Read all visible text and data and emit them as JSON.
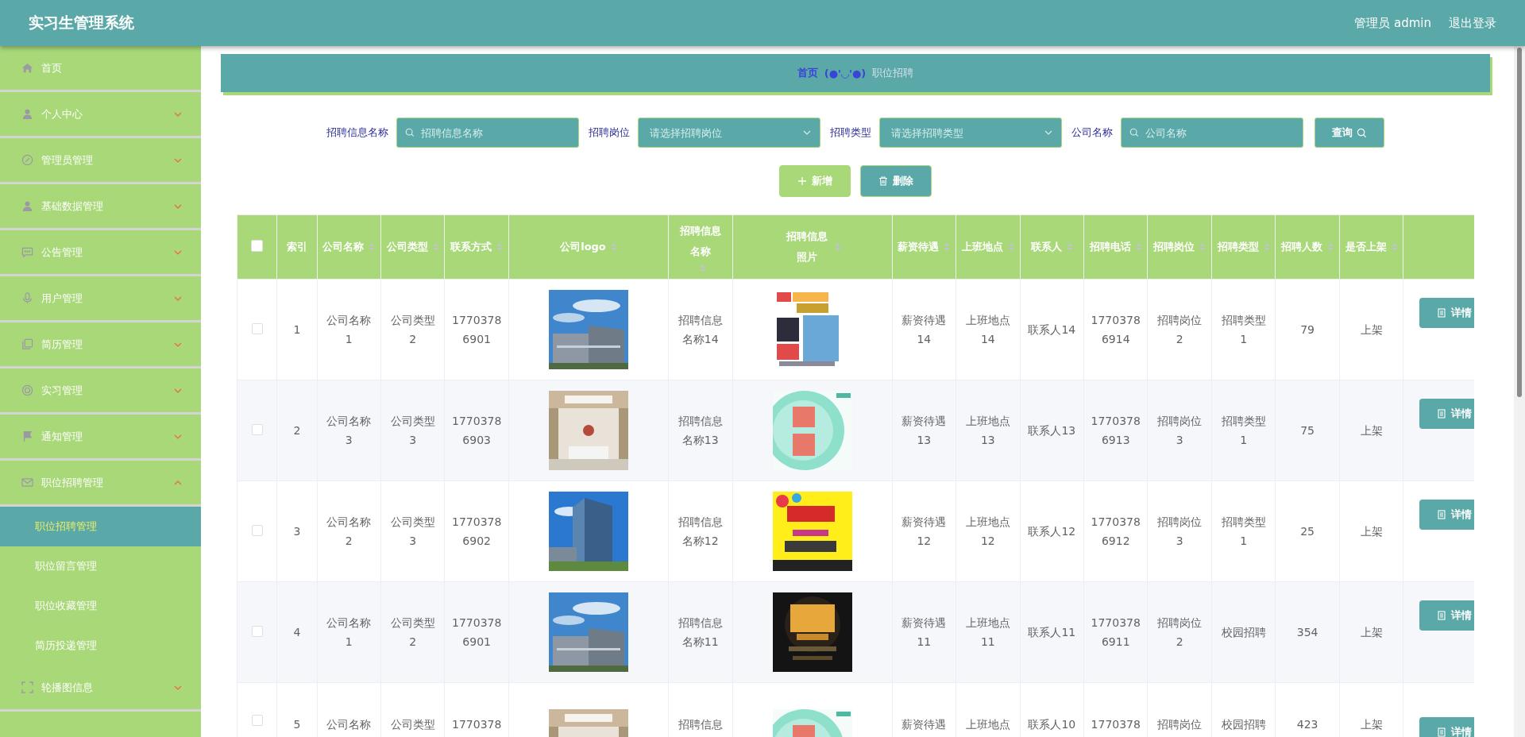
{
  "header": {
    "title": "实习生管理系统",
    "user": "管理员 admin",
    "logout": "退出登录"
  },
  "sidebar": {
    "items": [
      {
        "label": "首页",
        "kind": "link"
      },
      {
        "label": "个人中心",
        "kind": "group",
        "expanded": false
      },
      {
        "label": "管理员管理",
        "kind": "group",
        "expanded": false
      },
      {
        "label": "基础数据管理",
        "kind": "group",
        "expanded": false
      },
      {
        "label": "公告管理",
        "kind": "group",
        "expanded": false
      },
      {
        "label": "用户管理",
        "kind": "group",
        "expanded": false
      },
      {
        "label": "简历管理",
        "kind": "group",
        "expanded": false
      },
      {
        "label": "实习管理",
        "kind": "group",
        "expanded": false
      },
      {
        "label": "通知管理",
        "kind": "group",
        "expanded": false
      },
      {
        "label": "职位招聘管理",
        "kind": "group",
        "expanded": true,
        "children": [
          {
            "label": "职位招聘管理",
            "selected": true
          },
          {
            "label": "职位留言管理",
            "selected": false
          },
          {
            "label": "职位收藏管理",
            "selected": false
          },
          {
            "label": "简历投递管理",
            "selected": false
          }
        ]
      },
      {
        "label": "轮播图信息",
        "kind": "group",
        "expanded": false
      }
    ]
  },
  "breadcrumb": {
    "home": "首页",
    "separator": "(●'◡'●)",
    "current": "职位招聘"
  },
  "search": {
    "fields": [
      {
        "label": "招聘信息名称",
        "kind": "input",
        "placeholder": "招聘信息名称"
      },
      {
        "label": "招聘岗位",
        "kind": "select",
        "placeholder": "请选择招聘岗位"
      },
      {
        "label": "招聘类型",
        "kind": "select",
        "placeholder": "请选择招聘类型"
      },
      {
        "label": "公司名称",
        "kind": "input",
        "placeholder": "公司名称"
      }
    ],
    "query_button": "查询"
  },
  "actions": {
    "add": "新增",
    "delete": "删除"
  },
  "table": {
    "select_all_checked": false,
    "columns": [
      {
        "label": "索引",
        "kind": "text",
        "sortable": false
      },
      {
        "label": "公司名称",
        "kind": "text",
        "sortable": true
      },
      {
        "label": "公司类型",
        "kind": "text",
        "sortable": true
      },
      {
        "label": "联系方式",
        "kind": "phone",
        "sortable": true
      },
      {
        "label": "公司logo",
        "kind": "picture",
        "sortable": true
      },
      {
        "label": "招聘信息名称",
        "kind": "text",
        "sortable": true
      },
      {
        "label": "招聘信息照片",
        "kind": "picture",
        "sortable": true
      },
      {
        "label": "薪资待遇",
        "kind": "text",
        "sortable": true
      },
      {
        "label": "上班地点",
        "kind": "text",
        "sortable": true
      },
      {
        "label": "联系人",
        "kind": "text",
        "sortable": true
      },
      {
        "label": "招聘电话",
        "kind": "phone",
        "sortable": true
      },
      {
        "label": "招聘岗位",
        "kind": "text",
        "sortable": true
      },
      {
        "label": "招聘类型",
        "kind": "text",
        "sortable": true
      },
      {
        "label": "招聘人数",
        "kind": "text",
        "sortable": true
      },
      {
        "label": "是否上架",
        "kind": "text",
        "sortable": true
      }
    ],
    "rows": [
      {
        "checked": false,
        "detail": "详情",
        "cells": [
          "1",
          "公司名称1",
          "公司类型2",
          "17703786901",
          {
            "kind": "picture"
          },
          "招聘信息名称14",
          {
            "kind": "picture"
          },
          "薪资待遇14",
          "上班地点14",
          "联系人14",
          "17703786914",
          "招聘岗位2",
          "招聘类型1",
          "79",
          "上架"
        ]
      },
      {
        "checked": false,
        "detail": "详情",
        "cells": [
          "2",
          "公司名称3",
          "公司类型3",
          "17703786903",
          {
            "kind": "picture"
          },
          "招聘信息名称13",
          {
            "kind": "picture"
          },
          "薪资待遇13",
          "上班地点13",
          "联系人13",
          "17703786913",
          "招聘岗位3",
          "招聘类型1",
          "75",
          "上架"
        ]
      },
      {
        "checked": false,
        "detail": "详情",
        "cells": [
          "3",
          "公司名称2",
          "公司类型3",
          "17703786902",
          {
            "kind": "picture"
          },
          "招聘信息名称12",
          {
            "kind": "picture"
          },
          "薪资待遇12",
          "上班地点12",
          "联系人12",
          "17703786912",
          "招聘岗位3",
          "招聘类型1",
          "25",
          "上架"
        ]
      },
      {
        "checked": false,
        "detail": "详情",
        "cells": [
          "4",
          "公司名称1",
          "公司类型2",
          "17703786901",
          {
            "kind": "picture"
          },
          "招聘信息名称11",
          {
            "kind": "picture"
          },
          "薪资待遇11",
          "上班地点11",
          "联系人11",
          "17703786911",
          "招聘岗位2",
          "校园招聘",
          "354",
          "上架"
        ]
      },
      {
        "checked": false,
        "detail": "详情",
        "cells": [
          "5",
          "公司名称",
          "公司类型",
          "1770378",
          {
            "kind": "picture"
          },
          "招聘信息",
          {
            "kind": "picture"
          },
          "薪资待遇",
          "上班地点",
          "联系人10",
          "1770378",
          "招聘岗位",
          "校园招聘",
          "423",
          "上架"
        ]
      }
    ]
  }
}
